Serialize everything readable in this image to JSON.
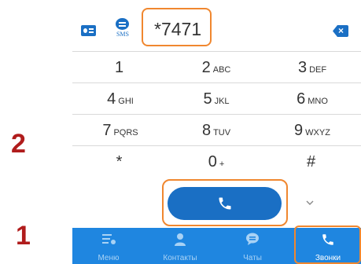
{
  "annotations": {
    "step_2": "2",
    "step_1": "1"
  },
  "header": {
    "sms_label": "SMS",
    "dial_value": "*7471"
  },
  "keypad": [
    [
      {
        "digit": "1",
        "letters": ""
      },
      {
        "digit": "2",
        "letters": "ABC"
      },
      {
        "digit": "3",
        "letters": "DEF"
      }
    ],
    [
      {
        "digit": "4",
        "letters": "GHI"
      },
      {
        "digit": "5",
        "letters": "JKL"
      },
      {
        "digit": "6",
        "letters": "MNO"
      }
    ],
    [
      {
        "digit": "7",
        "letters": "PQRS"
      },
      {
        "digit": "8",
        "letters": "TUV"
      },
      {
        "digit": "9",
        "letters": "WXYZ"
      }
    ],
    [
      {
        "digit": "*",
        "letters": ""
      },
      {
        "digit": "0",
        "letters": "+"
      },
      {
        "digit": "#",
        "letters": ""
      }
    ]
  ],
  "nav": {
    "menu": "Меню",
    "contacts": "Контакты",
    "chats": "Чаты",
    "calls": "Звонки",
    "active": "calls"
  },
  "colors": {
    "accent": "#1a6fc4",
    "nav_bar": "#1f86e0",
    "highlight": "#f0872f",
    "step_number": "#b01c1c"
  },
  "icons": {
    "contact_card": "contact-card-icon",
    "sms": "sms-icon",
    "backspace": "backspace-icon",
    "call": "phone-icon",
    "expand": "chevron-down-icon",
    "menu": "menu-icon",
    "contacts": "person-icon",
    "chats": "chat-icon",
    "calls": "phone-icon"
  }
}
